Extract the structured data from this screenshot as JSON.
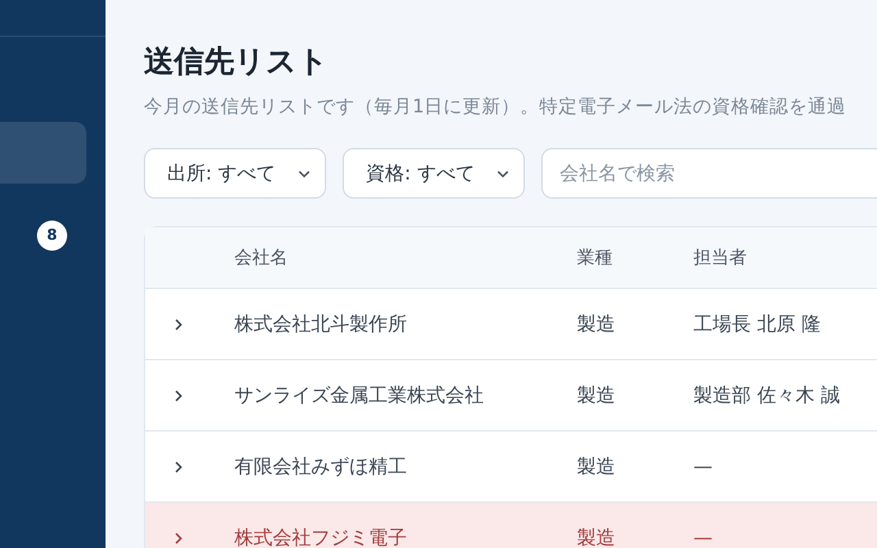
{
  "sidebar": {
    "items": [
      {
        "selected": true
      },
      {
        "badge": "8",
        "selected": false
      }
    ]
  },
  "page": {
    "title": "送信先リスト",
    "subtitle": "今月の送信先リストです（毎月1日に更新）。特定電子メール法の資格確認を通過"
  },
  "filters": [
    {
      "label": "出所: すべて"
    },
    {
      "label": "資格: すべて"
    }
  ],
  "search": {
    "placeholder": "会社名で検索"
  },
  "table": {
    "columns": [
      "会社名",
      "業種",
      "担当者"
    ],
    "rows": [
      {
        "company": "株式会社北斗製作所",
        "industry": "製造",
        "contact": "工場長 北原 隆",
        "flagged": false
      },
      {
        "company": "サンライズ金属工業株式会社",
        "industry": "製造",
        "contact": "製造部 佐々木 誠",
        "flagged": false
      },
      {
        "company": "有限会社みずほ精工",
        "industry": "製造",
        "contact": "—",
        "flagged": false
      },
      {
        "company": "株式会社フジミ電子",
        "industry": "製造",
        "contact": "—",
        "flagged": true
      }
    ]
  }
}
